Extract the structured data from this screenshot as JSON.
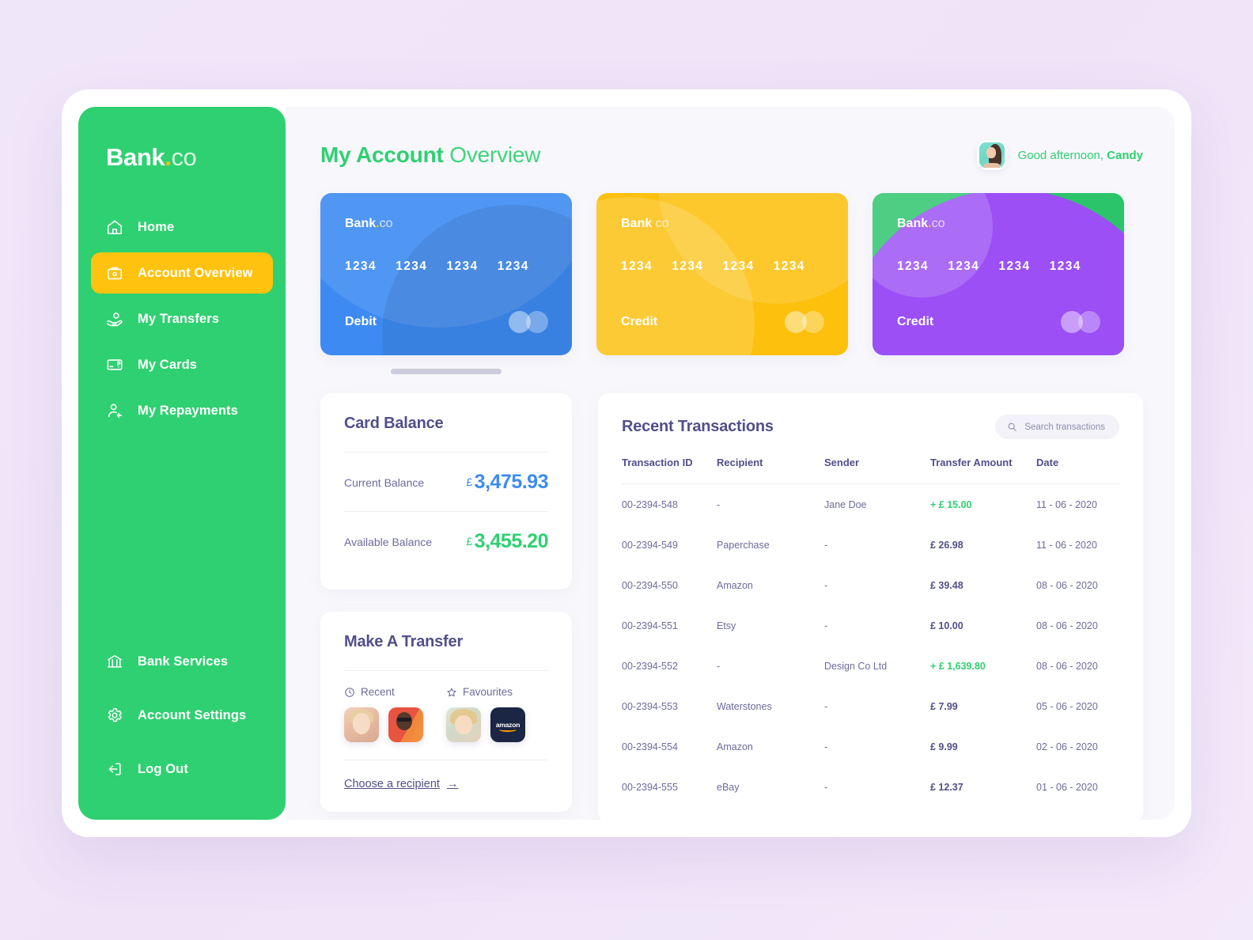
{
  "brand": {
    "name": "Bank",
    "dot": ".",
    "suffix": "co"
  },
  "sidebar": {
    "items": [
      {
        "label": "Home",
        "icon": "home-icon",
        "active": false
      },
      {
        "label": "Account Overview",
        "icon": "wallet-icon",
        "active": true
      },
      {
        "label": "My Transfers",
        "icon": "hand-coin-icon",
        "active": false
      },
      {
        "label": "My Cards",
        "icon": "card-icon",
        "active": false
      },
      {
        "label": "My Repayments",
        "icon": "user-return-icon",
        "active": false
      }
    ],
    "bottom_items": [
      {
        "label": "Bank Services",
        "icon": "bank-icon"
      },
      {
        "label": "Account Settings",
        "icon": "gear-icon"
      },
      {
        "label": "Log Out",
        "icon": "logout-icon"
      }
    ]
  },
  "header": {
    "title_bold": "My Account",
    "title_light": "Overview",
    "greeting_prefix": "Good afternoon, ",
    "greeting_name": "Candy",
    "avatar": "user-avatar"
  },
  "cards": [
    {
      "logo": "Bank",
      "logo_dot": ".",
      "logo_suffix": "co",
      "numbers": [
        "1234",
        "1234",
        "1234",
        "1234"
      ],
      "type": "Debit",
      "color": "#3d8bf2",
      "theme": "card-blue"
    },
    {
      "logo": "Bank",
      "logo_dot": ".",
      "logo_suffix": "co",
      "numbers": [
        "1234",
        "1234",
        "1234",
        "1234"
      ],
      "type": "Credit",
      "color": "#fcc00d",
      "theme": "card-yellow"
    },
    {
      "logo": "Bank",
      "logo_dot": ".",
      "logo_suffix": "co",
      "numbers": [
        "1234",
        "1234",
        "1234",
        "1234"
      ],
      "type": "Credit",
      "color": "#2bc46a",
      "accent": "#9b4ff5",
      "theme": "card-green"
    }
  ],
  "balance": {
    "title": "Card Balance",
    "rows": [
      {
        "label": "Current Balance",
        "currency": "£",
        "amount": "3,475.93",
        "color": "#3d8bf2"
      },
      {
        "label": "Available Balance",
        "currency": "£",
        "amount": "3,455.20",
        "color": "#2fd071"
      }
    ]
  },
  "transfer": {
    "title": "Make A Transfer",
    "recent_label": "Recent",
    "favourites_label": "Favourites",
    "recent_icon": "clock-icon",
    "favourites_icon": "star-icon",
    "recent_avatars": [
      "recipient-avatar-1",
      "recipient-avatar-2"
    ],
    "favourite_avatars": [
      "recipient-avatar-3",
      "amazon-logo"
    ],
    "amazon_label": "amazon",
    "choose_label": "Choose a recipient",
    "choose_arrow": "→"
  },
  "transactions": {
    "title": "Recent Transactions",
    "search_placeholder": "Search transactions",
    "search_icon": "search-icon",
    "columns": [
      "Transaction ID",
      "Recipient",
      "Sender",
      "Transfer Amount",
      "Date"
    ],
    "rows": [
      {
        "id": "00-2394-548",
        "recipient": "-",
        "sender": "Jane Doe",
        "amount": "+ £ 15.00",
        "credit": true,
        "date": "11 - 06 - 2020"
      },
      {
        "id": "00-2394-549",
        "recipient": "Paperchase",
        "sender": "-",
        "amount": "£ 26.98",
        "credit": false,
        "date": "11 - 06 - 2020"
      },
      {
        "id": "00-2394-550",
        "recipient": "Amazon",
        "sender": "-",
        "amount": "£ 39.48",
        "credit": false,
        "date": "08 - 06 - 2020"
      },
      {
        "id": "00-2394-551",
        "recipient": "Etsy",
        "sender": "-",
        "amount": "£ 10.00",
        "credit": false,
        "date": "08 - 06 - 2020"
      },
      {
        "id": "00-2394-552",
        "recipient": "-",
        "sender": "Design Co Ltd",
        "amount": "+ £ 1,639.80",
        "credit": true,
        "date": "08 - 06 - 2020"
      },
      {
        "id": "00-2394-553",
        "recipient": "Waterstones",
        "sender": "-",
        "amount": "£ 7.99",
        "credit": false,
        "date": "05 - 06 - 2020"
      },
      {
        "id": "00-2394-554",
        "recipient": "Amazon",
        "sender": "-",
        "amount": "£ 9.99",
        "credit": false,
        "date": "02 - 06 - 2020"
      },
      {
        "id": "00-2394-555",
        "recipient": "eBay",
        "sender": "-",
        "amount": "£ 12.37",
        "credit": false,
        "date": "01 - 06 - 2020"
      }
    ]
  },
  "colors": {
    "brand_green": "#2fd071",
    "accent_yellow": "#ffc20e",
    "card_blue": "#3d8bf2",
    "card_yellow": "#fcc00d",
    "card_purple": "#9b4ff5",
    "text_dark": "#514f8a",
    "text_muted": "#6d6b9c"
  }
}
